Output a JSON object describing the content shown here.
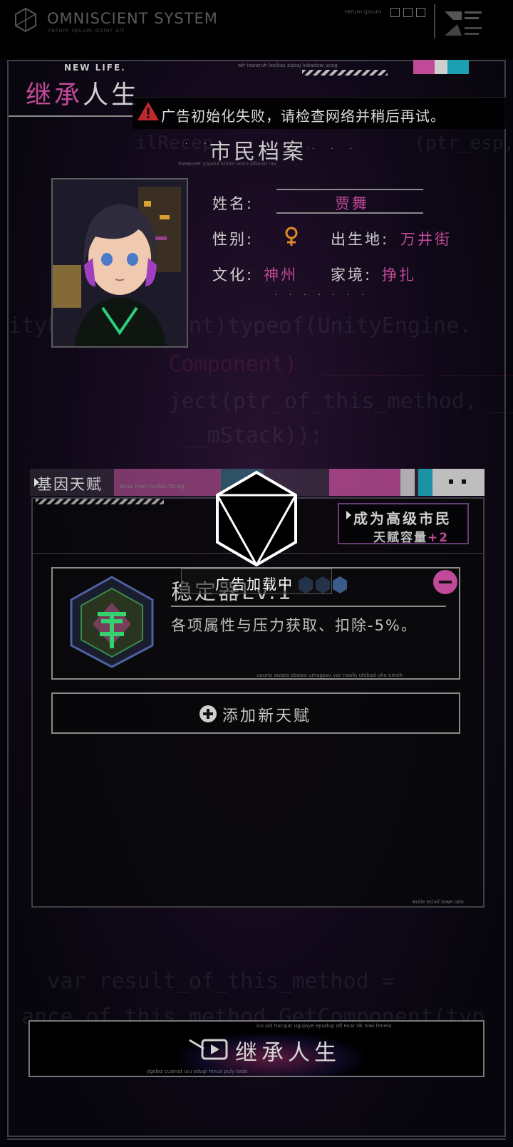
{
  "system": {
    "title": "OMNISCIENT SYSTEM",
    "subtitle": "rerum ipsum dolor sit",
    "tiny_top": "rerum ipsum"
  },
  "header": {
    "new_life": "NEW LIFE.",
    "title_part1": "继承",
    "title_part2": "人生",
    "tiny_text": "wir iowaruh lesikas aubaj lubadaw uceg"
  },
  "ad_error": {
    "message": "广告初始化失败，请检查网络并稍后再试。"
  },
  "citizen_file": {
    "title": "市民档案",
    "subtitle": "mewovet yojaluf kinim vono zifonaf rav",
    "name_label": "姓名:",
    "name_value": "贾舞",
    "gender_label": "性别:",
    "gender_icon": "female-icon",
    "birthplace_label": "出生地:",
    "birthplace_value": "万井街",
    "culture_label": "文化:",
    "culture_value": "神州",
    "family_label": "家境:",
    "family_value": "挣扎"
  },
  "gene_talent": {
    "title": "基因天赋",
    "tiny_text": "evaz men ivutas fiz eg",
    "upgrade_line1": "成为高级市民",
    "upgrade_line2": "天赋容量",
    "upgrade_plus": "+2",
    "talent_name": "稳定器Lv.1",
    "talent_desc": "各项属性与压力获取、扣除-5%。",
    "talent_tiny": "uaurio auoza ebawa umagsvu var riaofu uhibad uho emeh",
    "add_label": "添加新天赋",
    "gene_tiny2": "wulie eciail iowe udo"
  },
  "loading": {
    "text": "广告加载中"
  },
  "inherit": {
    "label": "继承人生",
    "tiny1": "ico sid hacajat ugujoye epudup ofi exar rik niwi fenela",
    "tiny2": "jigobiz cusinat iau odugi hinus puly tedo"
  },
  "colors": {
    "accent_pink": "#c04a97",
    "teal": "#1aa0b0",
    "text_light": "#d6d6d6"
  },
  "background_code": [
    "ilRecep        .         (ptr_esp, 1);",
    "mewovet",
    "      ...  =",
    "ityE         ent)typeof(UnityEngine.",
    "       Component)  ________ ________",
    "       ject(ptr_of_this_method, __domain,",
    "        __mStack));",
    "   var result_of_this_method =",
    " ance_of_this_method.GetComponent(typ"
  ]
}
